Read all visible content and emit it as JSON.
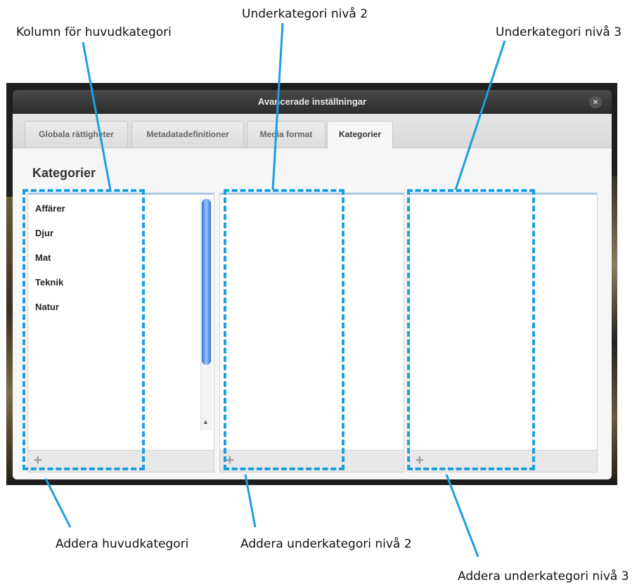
{
  "annotations": {
    "main_column": "Kolumn för huvudkategori",
    "sub_level2": "Underkategori nivå 2",
    "sub_level3": "Underkategori nivå 3",
    "add_main": "Addera huvudkategori",
    "add_sub2": "Addera underkategori nivå 2",
    "add_sub3": "Addera underkategori nivå 3"
  },
  "window": {
    "title": "Avancerade inställningar",
    "close_label": "×"
  },
  "tabs": [
    {
      "label": "Globala rättigheter"
    },
    {
      "label": "Metadatadefinitioner"
    },
    {
      "label": "Media format"
    },
    {
      "label": "Kategorier"
    }
  ],
  "active_tab": "Kategorier",
  "section_title": "Kategorier",
  "categories": [
    "Affärer",
    "Djur",
    "Mat",
    "Teknik",
    "Natur"
  ],
  "add_label": "+",
  "colors": {
    "annotation": "#1aa0e0",
    "accent": "#a9c8e4",
    "scroll_thumb": "#2f6fd0"
  }
}
